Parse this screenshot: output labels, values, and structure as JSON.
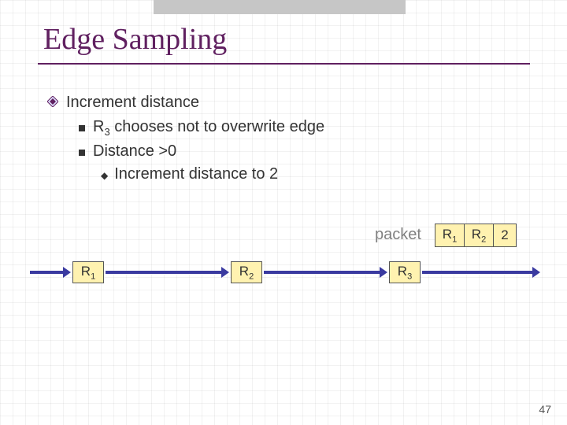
{
  "title": "Edge Sampling",
  "bullet_main": "Increment distance",
  "sub1_prefix": "R",
  "sub1_sub": "3",
  "sub1_rest": " chooses not to overwrite edge",
  "sub2": "Distance >0",
  "sub2a": "Increment distance to 2",
  "packet_label": "packet",
  "packet_cell1_prefix": "R",
  "packet_cell1_sub": "1",
  "packet_cell2_prefix": "R",
  "packet_cell2_sub": "2",
  "packet_cell3": "2",
  "node1_prefix": "R",
  "node1_sub": "1",
  "node2_prefix": "R",
  "node2_sub": "2",
  "node3_prefix": "R",
  "node3_sub": "3",
  "page_num": "47"
}
